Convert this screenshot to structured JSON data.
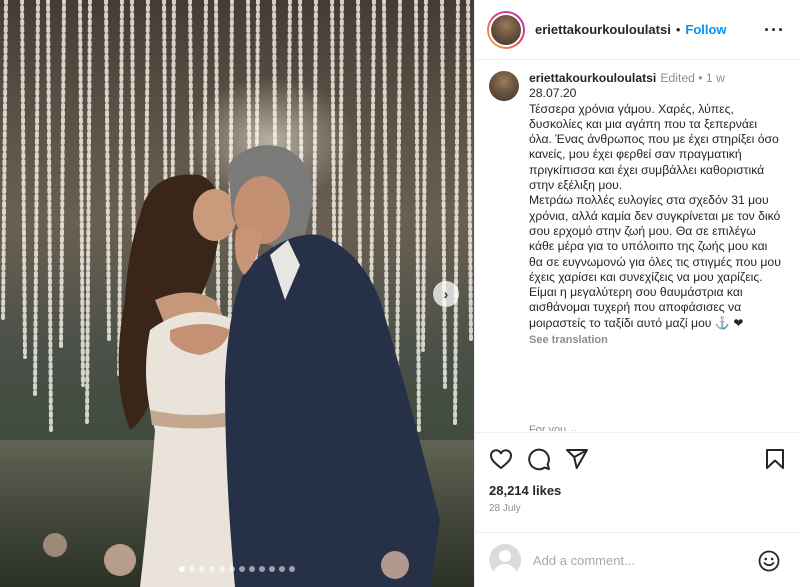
{
  "post": {
    "username": "eriettakourkouloulatsi",
    "follow_label": "Follow",
    "separator": "•",
    "more_label": "···"
  },
  "caption": {
    "username": "eriettakourkouloulatsi",
    "meta": "Edited • 1 w",
    "text": "28.07.20\nΤέσσερα χρόνια γάμου. Χαρές, λύπες, δυσκολίες και μια αγάπη που τα ξεπερνάει όλα. Ένας άνθρωπος που με έχει στηρίξει όσο κανείς, μου έχει φερθεί σαν πραγματική πριγκίπισσα και έχει συμβάλλει καθοριστικά στην εξέλιξη μου.\nΜετράω πολλές ευλογίες στα σχεδόν 31 μου χρόνια, αλλά καμία δεν συγκρίνεται με τον δικό σου ερχομό στην ζωή μου. Θα σε επιλέγω κάθε μέρα για το υπόλοιπο της ζωής μου και θα σε ευγνωμονώ για όλες τις στιγμές που μου έχεις χαρίσει και συνεχίζεις να μου χαρίζεις. Είμαι η μεγαλύτερη σου θαυμάστρια και αισθάνομαι τυχερή που αποφάσισες να μοιραστείς το ταξίδι αυτό μαζί μου ⚓ ❤",
    "see_translation": "See translation",
    "cut_text": "For you ⌄"
  },
  "actions": {
    "likes": "28,214 likes",
    "date": "28 July"
  },
  "comment": {
    "placeholder": "Add a comment..."
  },
  "carousel": {
    "dot_count": 12,
    "active_index": 0
  },
  "icons": {
    "like": "heart-icon",
    "comment": "comment-icon",
    "share": "paper-plane-icon",
    "save": "bookmark-icon",
    "emoji": "smiley-icon",
    "next": "chevron-right-icon"
  }
}
